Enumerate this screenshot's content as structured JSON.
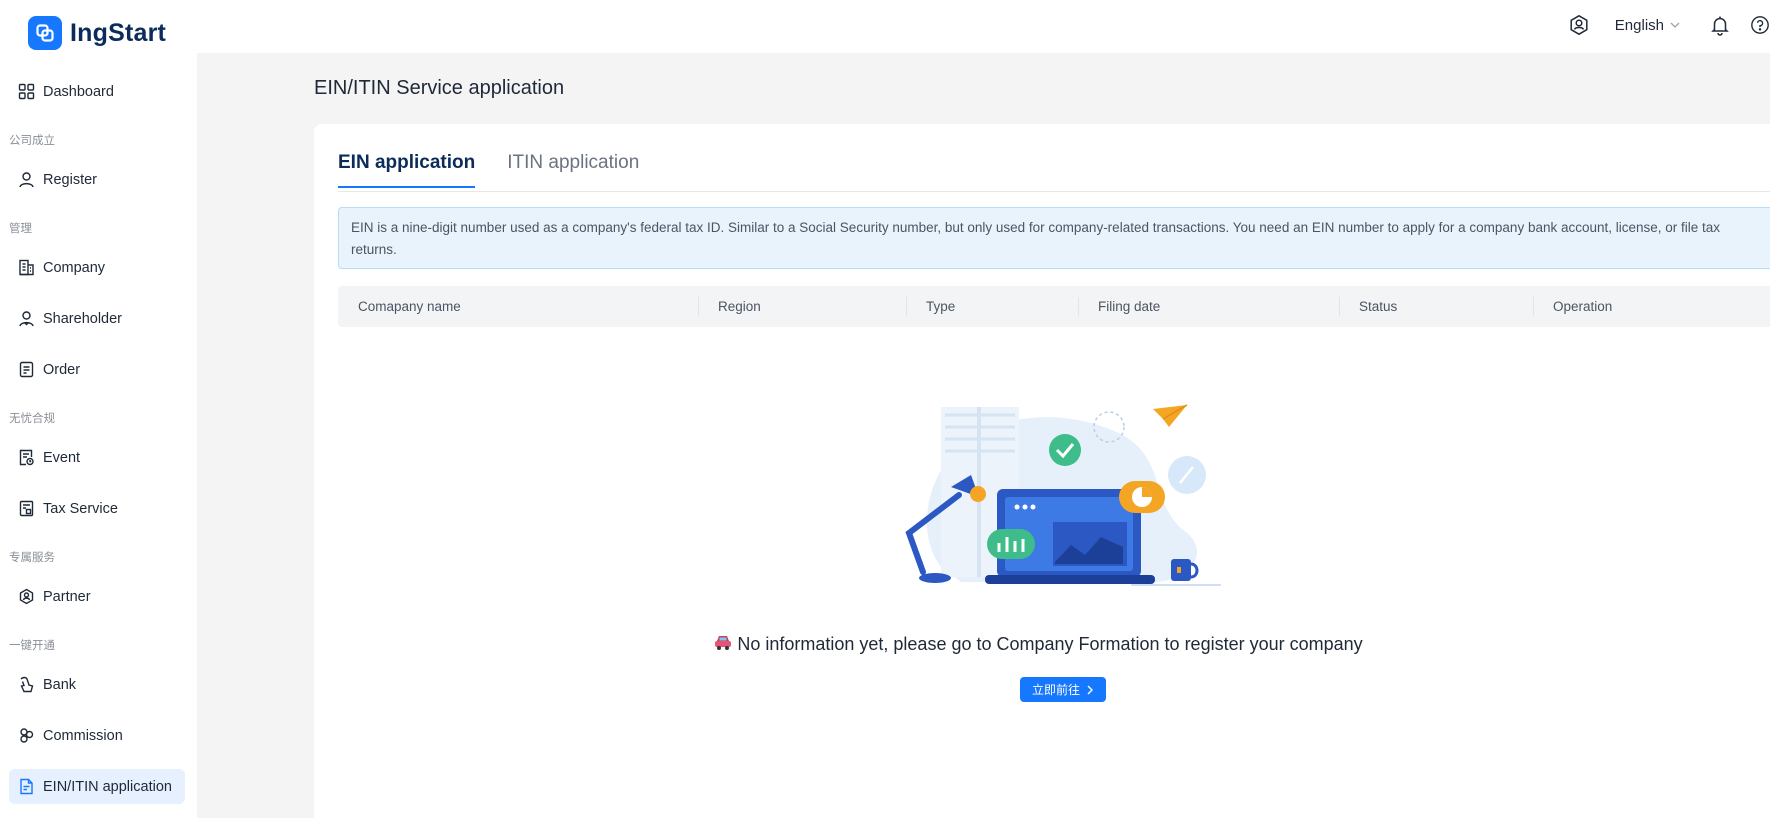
{
  "app": {
    "name": "IngStart"
  },
  "header": {
    "language": "English",
    "icons": [
      "account-icon",
      "bell-icon",
      "help-icon"
    ]
  },
  "sidebar": {
    "dashboard": "Dashboard",
    "group_company_setup": "公司成立",
    "register": "Register",
    "group_manage": "管理",
    "company": "Company",
    "shareholder": "Shareholder",
    "order": "Order",
    "group_compliance": "无忧合规",
    "event": "Event",
    "tax_service": "Tax Service",
    "group_exclusive": "专属服务",
    "partner": "Partner",
    "group_one_click": "一键开通",
    "bank": "Bank",
    "commission": "Commission",
    "ein_itin": "EIN/ITIN application"
  },
  "main": {
    "title": "EIN/ITIN Service application",
    "tabs": [
      "EIN application",
      "ITIN application"
    ],
    "info": "EIN is a nine-digit number used as a company's federal tax ID. Similar to a Social Security number, but only used for company-related transactions. You need an EIN number to apply for a company bank account, license, or file tax returns.",
    "columns": [
      "Comapany name",
      "Region",
      "Type",
      "Filing date",
      "Status",
      "Operation"
    ],
    "empty_message": "No information yet, please go to Company Formation to register your company",
    "go_button": "立即前往"
  },
  "colors": {
    "accent": "#1677ff",
    "brand_text": "#0b2c5a",
    "info_bg": "#e8f3fc"
  }
}
